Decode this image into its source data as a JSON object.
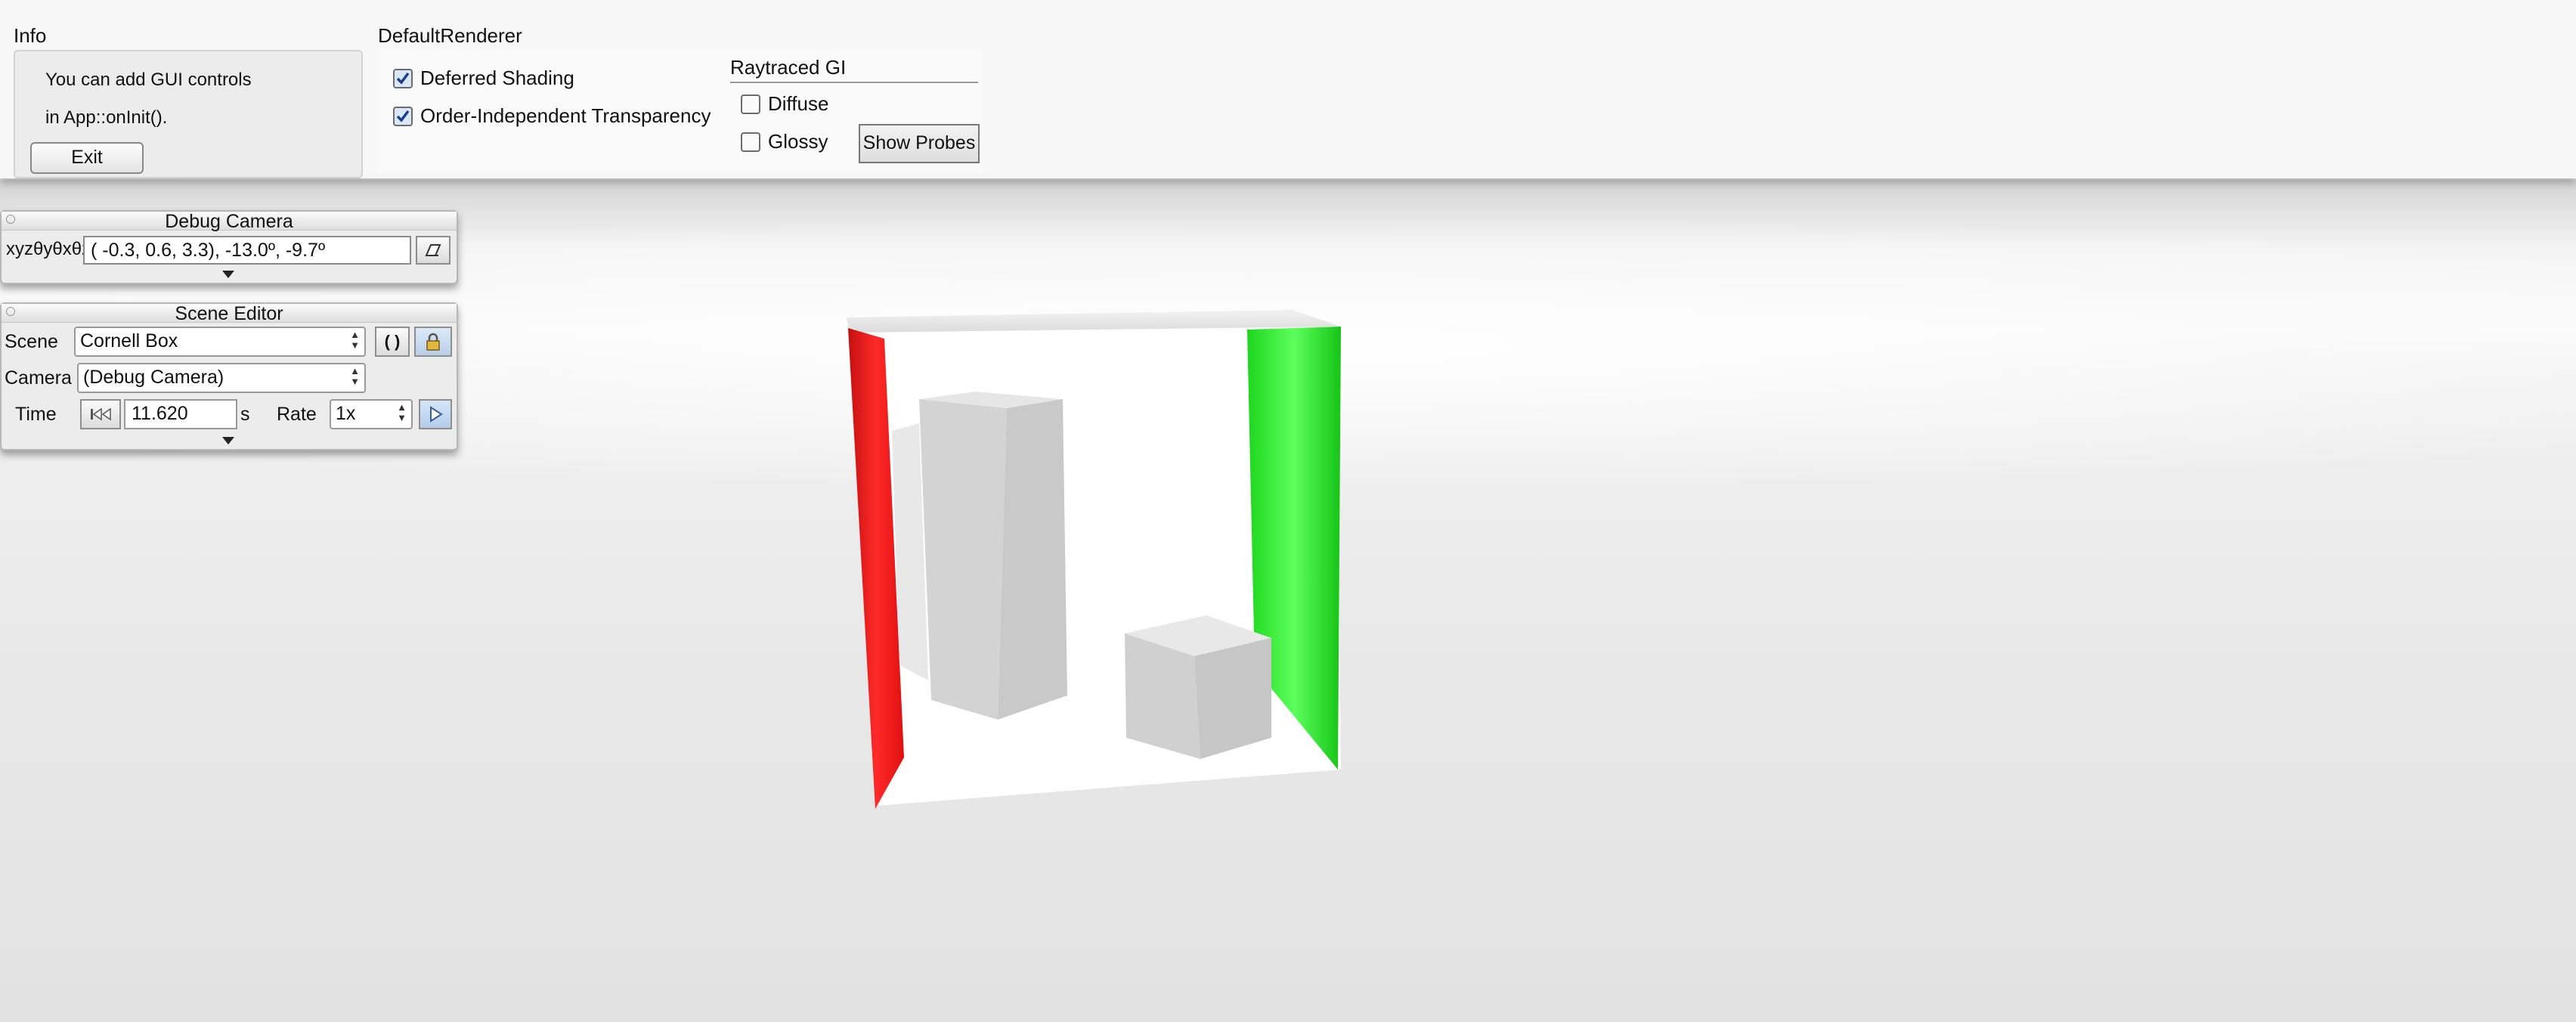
{
  "top_dock": {
    "info": {
      "title": "Info",
      "line1": "You can add GUI controls",
      "line2": "in App::onInit().",
      "exit_label": "Exit"
    },
    "renderer": {
      "title": "DefaultRenderer",
      "deferred_shading": {
        "label": "Deferred Shading",
        "checked": true
      },
      "oit": {
        "label": "Order-Independent Transparency",
        "checked": true
      },
      "gi_title": "Raytraced GI",
      "diffuse": {
        "label": "Diffuse",
        "checked": false
      },
      "glossy": {
        "label": "Glossy",
        "checked": false
      },
      "show_probes_label": "Show Probes"
    }
  },
  "debug_camera": {
    "title": "Debug Camera",
    "label": "xyzθyθxθz",
    "value": "( -0.3,   0.6,   3.3), -13.0º,  -9.7º",
    "copy_icon": "clipboard-icon"
  },
  "scene_editor": {
    "title": "Scene Editor",
    "scene_label": "Scene",
    "scene_value": "Cornell Box",
    "camera_label": "Camera",
    "camera_value": "(Debug Camera)",
    "time_label": "Time",
    "time_value": "11.620",
    "time_unit": "s",
    "rate_label": "Rate",
    "rate_value": "1x",
    "reload_icon": "reload-icon",
    "lock_icon": "lock-icon",
    "play_icon": "play-icon",
    "reset_icon": "rewind-icon"
  },
  "colors": {
    "red_wall": "#ff2020",
    "green_wall": "#22ee22",
    "accent": "#c9dcf3"
  }
}
